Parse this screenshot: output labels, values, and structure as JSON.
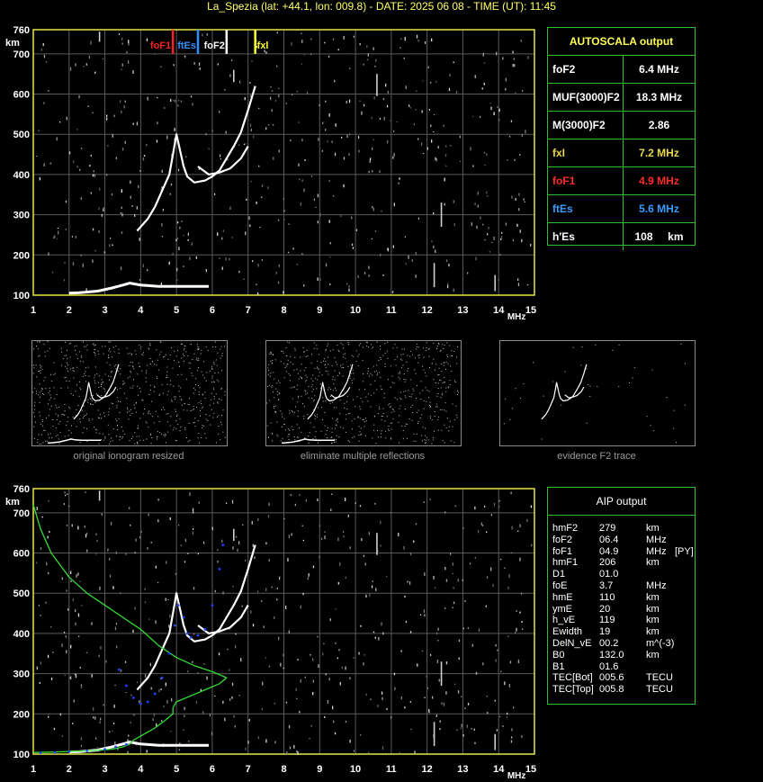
{
  "header": "La_Spezia (lat: +44.1, lon: 009.8) - DATE: 2025 06 08 - TIME (UT): 11:45",
  "chart_data": [
    {
      "type": "scatter",
      "name": "ionogram-autoscala",
      "ylabel": "km",
      "xlabel": "MHz",
      "xlim": [
        1,
        15
      ],
      "ylim": [
        100,
        760
      ],
      "xticks": [
        "1",
        "2",
        "3",
        "4",
        "5",
        "6",
        "7",
        "8",
        "9",
        "10",
        "11",
        "12",
        "13",
        "14",
        "15"
      ],
      "yticks": [
        "100",
        "200",
        "300",
        "400",
        "500",
        "600",
        "700",
        "760"
      ],
      "grid": true,
      "markers": [
        {
          "label": "foF1",
          "x": 4.9,
          "color": "#ff2020"
        },
        {
          "label": "ftEs",
          "x": 5.6,
          "color": "#3090ff"
        },
        {
          "label": "foF2",
          "x": 6.4,
          "color": "#ffffff"
        },
        {
          "label": "fxl",
          "x": 7.2,
          "color": "#ffff30"
        }
      ],
      "trace_f2_o": [
        [
          3.9,
          260
        ],
        [
          4.2,
          290
        ],
        [
          4.4,
          320
        ],
        [
          4.6,
          360
        ],
        [
          4.8,
          400
        ],
        [
          4.9,
          450
        ],
        [
          5.0,
          500
        ],
        [
          5.1,
          460
        ],
        [
          5.2,
          420
        ],
        [
          5.3,
          395
        ],
        [
          5.5,
          380
        ],
        [
          5.8,
          385
        ],
        [
          6.0,
          395
        ],
        [
          6.2,
          410
        ],
        [
          6.4,
          440
        ],
        [
          6.6,
          470
        ],
        [
          6.8,
          505
        ],
        [
          7.0,
          560
        ],
        [
          7.2,
          620
        ]
      ],
      "trace_f2_x": [
        [
          5.6,
          420
        ],
        [
          5.9,
          400
        ],
        [
          6.2,
          405
        ],
        [
          6.5,
          415
        ],
        [
          6.8,
          440
        ],
        [
          7.0,
          470
        ]
      ],
      "trace_e": [
        [
          2.0,
          105
        ],
        [
          2.3,
          106
        ],
        [
          2.8,
          110
        ],
        [
          3.2,
          118
        ],
        [
          3.5,
          125
        ],
        [
          3.7,
          130
        ],
        [
          4.0,
          125
        ],
        [
          4.5,
          122
        ],
        [
          5.0,
          122
        ],
        [
          5.5,
          122
        ],
        [
          5.9,
          122
        ]
      ]
    },
    {
      "type": "scatter",
      "name": "ionogram-aip",
      "ylabel": "km",
      "xlabel": "MHz",
      "xlim": [
        1,
        15
      ],
      "ylim": [
        100,
        760
      ],
      "xticks": [
        "1",
        "2",
        "3",
        "4",
        "5",
        "6",
        "7",
        "8",
        "9",
        "10",
        "11",
        "12",
        "13",
        "14",
        "15"
      ],
      "yticks": [
        "100",
        "200",
        "300",
        "400",
        "500",
        "600",
        "700",
        "760"
      ],
      "grid": true,
      "profile": [
        [
          1.0,
          720
        ],
        [
          1.2,
          660
        ],
        [
          1.5,
          600
        ],
        [
          2.0,
          540
        ],
        [
          2.5,
          500
        ],
        [
          3.0,
          470
        ],
        [
          3.5,
          440
        ],
        [
          4.0,
          410
        ],
        [
          4.5,
          370
        ],
        [
          5.0,
          340
        ],
        [
          5.5,
          320
        ],
        [
          6.0,
          305
        ],
        [
          6.4,
          290
        ],
        [
          6.2,
          275
        ],
        [
          5.8,
          260
        ],
        [
          5.4,
          245
        ],
        [
          5.0,
          230
        ],
        [
          4.9,
          215
        ],
        [
          4.9,
          200
        ],
        [
          4.7,
          185
        ],
        [
          4.4,
          165
        ],
        [
          4.1,
          150
        ],
        [
          3.8,
          135
        ],
        [
          3.7,
          125
        ],
        [
          3.5,
          118
        ],
        [
          3.2,
          112
        ],
        [
          2.5,
          108
        ],
        [
          1.5,
          105
        ],
        [
          1.0,
          104
        ]
      ],
      "fit_points": [
        [
          3.4,
          310
        ],
        [
          3.6,
          270
        ],
        [
          3.8,
          240
        ],
        [
          4.0,
          225
        ],
        [
          4.2,
          230
        ],
        [
          4.4,
          250
        ],
        [
          4.6,
          290
        ],
        [
          4.8,
          350
        ],
        [
          4.95,
          420
        ],
        [
          5.05,
          470
        ],
        [
          5.2,
          440
        ],
        [
          5.3,
          400
        ],
        [
          5.4,
          390
        ],
        [
          5.6,
          395
        ],
        [
          5.8,
          410
        ],
        [
          6.0,
          470
        ],
        [
          6.2,
          560
        ],
        [
          6.3,
          620
        ],
        [
          1.2,
          103
        ],
        [
          1.6,
          104
        ],
        [
          2.0,
          106
        ],
        [
          2.5,
          108
        ],
        [
          3.0,
          112
        ],
        [
          3.3,
          118
        ],
        [
          3.6,
          124
        ]
      ]
    }
  ],
  "autoscala": {
    "title": "AUTOSCALA output",
    "rows": [
      {
        "label": "foF2",
        "value": "6.4 MHz",
        "label_color": "#ffffff",
        "value_color": "#ffffff"
      },
      {
        "label": "MUF(3000)F2",
        "value": "18.3 MHz",
        "label_color": "#ffffff",
        "value_color": "#ffffff"
      },
      {
        "label": "M(3000)F2",
        "value": "2.86",
        "label_color": "#ffffff",
        "value_color": "#ffffff"
      },
      {
        "label": "fxI",
        "value": "7.2 MHz",
        "label_color": "#e8d84a",
        "value_color": "#e8d84a"
      },
      {
        "label": "foF1",
        "value": "4.9 MHz",
        "label_color": "#ff2a2a",
        "value_color": "#ff2a2a"
      },
      {
        "label": "ftEs",
        "value": "5.6 MHz",
        "label_color": "#3a9bff",
        "value_color": "#3a9bff"
      },
      {
        "label": "h'Es",
        "value": "108     km",
        "label_color": "#ffffff",
        "value_color": "#ffffff"
      }
    ]
  },
  "thumbs": [
    {
      "caption": "original ionogram resized"
    },
    {
      "caption": "eliminate multiple reflections"
    },
    {
      "caption": "evidence F2 trace"
    }
  ],
  "aip": {
    "title": "AIP output",
    "rows": [
      {
        "k": "hmF2",
        "v": "279",
        "u": "km",
        "x": ""
      },
      {
        "k": "foF2",
        "v": "06.4",
        "u": "MHz",
        "x": ""
      },
      {
        "k": "foF1",
        "v": "04.9",
        "u": "MHz",
        "x": "[PY]"
      },
      {
        "k": "hmF1",
        "v": "206",
        "u": "km",
        "x": ""
      },
      {
        "k": "D1",
        "v": "01.0",
        "u": "",
        "x": ""
      },
      {
        "k": "foE",
        "v": "3.7",
        "u": "MHz",
        "x": ""
      },
      {
        "k": "hmE",
        "v": "110",
        "u": "km",
        "x": ""
      },
      {
        "k": "ymE",
        "v": "20",
        "u": "km",
        "x": ""
      },
      {
        "k": "h_vE",
        "v": "119",
        "u": "km",
        "x": ""
      },
      {
        "k": "Ewidth",
        "v": "19",
        "u": "km",
        "x": ""
      },
      {
        "k": "DelN_vE",
        "v": "00.2",
        "u": "m^(-3)",
        "x": ""
      },
      {
        "k": "B0",
        "v": "132.0",
        "u": "km",
        "x": ""
      },
      {
        "k": "B1",
        "v": "01.6",
        "u": "",
        "x": ""
      },
      {
        "k": "TEC[Bot]",
        "v": "005.6",
        "u": "TECU",
        "x": ""
      },
      {
        "k": "TEC[Top]",
        "v": "005.8",
        "u": "TECU",
        "x": ""
      }
    ]
  }
}
